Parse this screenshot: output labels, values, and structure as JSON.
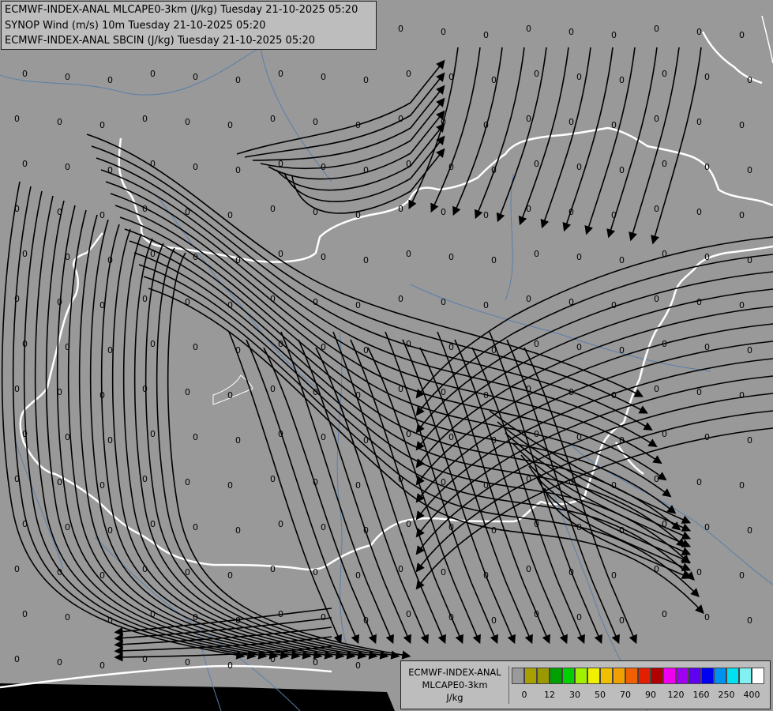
{
  "header": {
    "line1": "ECMWF-INDEX-ANAL MLCAPE0-3km (J/kg) Tuesday 21-10-2025 05:20",
    "line2": "SYNOP Wind (m/s) 10m Tuesday 21-10-2025 05:20",
    "line3": "ECMWF-INDEX-ANAL SBCIN (J/kg) Tuesday 21-10-2025 05:20"
  },
  "legend": {
    "title_line1": "ECMWF-INDEX-ANAL",
    "title_line2": "MLCAPE0-3km",
    "unit": "J/kg",
    "colors": [
      "#9a9a9a",
      "#a89f00",
      "#9a9a00",
      "#00a000",
      "#00d000",
      "#a0f000",
      "#f0f000",
      "#f0c000",
      "#f0a000",
      "#f06000",
      "#e02000",
      "#b00000",
      "#f000f0",
      "#a000f0",
      "#6000f0",
      "#0000f0",
      "#0090f0",
      "#00e0f0",
      "#80f0f0",
      "#ffffff"
    ],
    "tick_labels": [
      "0",
      "12",
      "30",
      "50",
      "70",
      "90",
      "120",
      "160",
      "250",
      "400"
    ]
  },
  "map_labels": {
    "value": "0"
  },
  "colors": {
    "background": "#999999",
    "border": "#ffffff",
    "river": "#5a7faa",
    "streamline": "#000000"
  }
}
